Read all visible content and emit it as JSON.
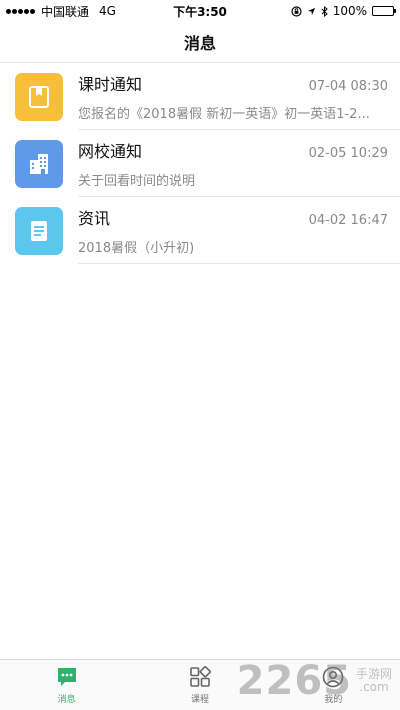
{
  "status_bar": {
    "carrier": "中国联通",
    "network": "4G",
    "time": "下午3:50",
    "battery": "100%",
    "battery_level": 1.0
  },
  "header": {
    "title": "消息"
  },
  "messages": [
    {
      "title": "课时通知",
      "time": "07-04 08:30",
      "preview": "您报名的《2018暑假 新初一英语》初一英语1-2...",
      "icon": "book-icon",
      "icon_color": "#f7bf3a"
    },
    {
      "title": "网校通知",
      "time": "02-05 10:29",
      "preview": "关于回看时间的说明",
      "icon": "building-icon",
      "icon_color": "#5f9ae8"
    },
    {
      "title": "资讯",
      "time": "04-02 16:47",
      "preview": "2018暑假（小升初)",
      "icon": "document-icon",
      "icon_color": "#5cc6ef"
    }
  ],
  "tab_bar": {
    "tabs": [
      {
        "label": "消息",
        "icon": "chat-icon",
        "active": true
      },
      {
        "label": "课程",
        "icon": "grid-icon",
        "active": false
      },
      {
        "label": "我的",
        "icon": "user-icon",
        "active": false
      }
    ],
    "accent": "#2fb36c"
  },
  "watermark": {
    "number": "2265",
    "tagline_line1": "手游网",
    "tagline_line2": ".com"
  }
}
